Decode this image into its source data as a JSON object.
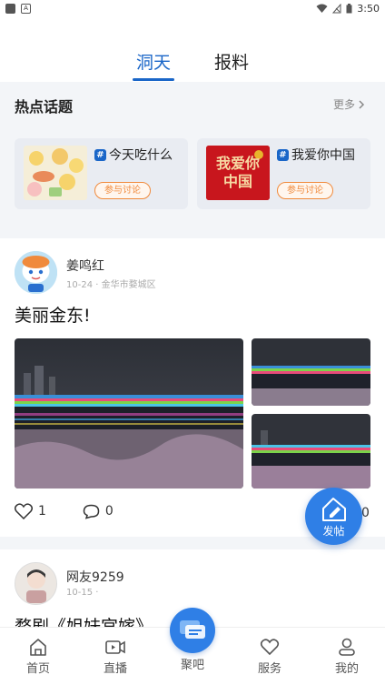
{
  "status_bar": {
    "time": "3:50",
    "a_badge": "A"
  },
  "top_tabs": [
    {
      "label": "洞天",
      "active": true
    },
    {
      "label": "报料",
      "active": false
    }
  ],
  "hot_topics": {
    "title": "热点话题",
    "more_label": "更多",
    "items": [
      {
        "title": "今天吃什么",
        "join_label": "参与讨论"
      },
      {
        "title": "我爱你中国",
        "join_label": "参与讨论",
        "image_text": "我爱你中国"
      }
    ]
  },
  "posts": [
    {
      "author": "姜鸣红",
      "meta": "10-24 · 金华市婺城区",
      "title": "美丽金东!",
      "likes": "1",
      "comments": "0",
      "shares": "0"
    },
    {
      "author": "网友9259",
      "meta": "10-15 ·",
      "title": "婺剧《姐妹宫嫁》"
    }
  ],
  "fab": {
    "label": "发帖"
  },
  "bottom_nav": [
    {
      "label": "首页",
      "icon": "home-icon"
    },
    {
      "label": "直播",
      "icon": "video-icon"
    },
    {
      "label": "聚吧",
      "icon": "chat-icon"
    },
    {
      "label": "服务",
      "icon": "heart-icon"
    },
    {
      "label": "我的",
      "icon": "user-icon"
    }
  ],
  "colors": {
    "accent": "#1a66c8",
    "fab": "#2f7fe6",
    "join": "#f08a3c"
  }
}
